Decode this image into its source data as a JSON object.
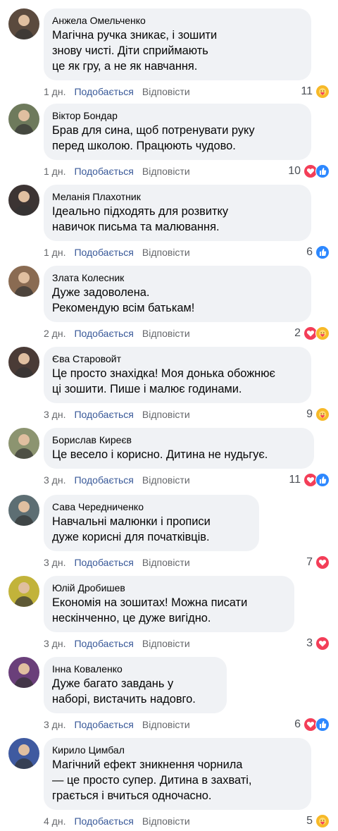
{
  "actions": {
    "like": "Подобається",
    "reply": "Відповісти"
  },
  "comments": [
    {
      "name": "Анжела Омельченко",
      "lines": [
        "Магічна ручка зникає, і зошити",
        "знову чисті. Діти сприймають",
        "це як гру, а не як навчання."
      ],
      "time": "1 дн.",
      "count": "11",
      "reactions": [
        "care"
      ],
      "avatar_color": "#5b4a3e"
    },
    {
      "name": "Віктор Бондар",
      "lines": [
        "Брав для сина, щоб потренувати руку",
        "перед школою. Працюють чудово."
      ],
      "time": "1 дн.",
      "count": "10",
      "reactions": [
        "love",
        "like"
      ],
      "avatar_color": "#6e7a5c"
    },
    {
      "name": "Меланія Плахотник",
      "lines": [
        "Ідеально підходять для розвитку",
        "навичок письма та малювання."
      ],
      "time": "1 дн.",
      "count": "6",
      "reactions": [
        "like"
      ],
      "avatar_color": "#3c3433"
    },
    {
      "name": "Злата Колесник",
      "lines": [
        "Дуже задоволена.",
        "Рекомендую всім батькам!"
      ],
      "time": "2 дн.",
      "count": "2",
      "reactions": [
        "love",
        "care"
      ],
      "avatar_color": "#8a6b52"
    },
    {
      "name": "Єва Старовойт",
      "lines": [
        "Це просто знахідка! Моя донька обожнює",
        "ці зошити. Пише і малює годинами."
      ],
      "time": "3 дн.",
      "count": "9",
      "reactions": [
        "care"
      ],
      "avatar_color": "#4a3b36"
    },
    {
      "name": "Борислав Киреєв",
      "lines": [
        "Це весело і корисно. Дитина не нудьгує."
      ],
      "time": "3 дн.",
      "count": "11",
      "reactions": [
        "love",
        "like"
      ],
      "avatar_color": "#8c9470"
    },
    {
      "name": "Сава Чередниченко",
      "lines": [
        "Навчальні малюнки і прописи",
        "дуже корисні для початківців."
      ],
      "time": "3 дн.",
      "count": "7",
      "reactions": [
        "love"
      ],
      "avatar_color": "#5d6e73"
    },
    {
      "name": "Юлій Дробишев",
      "lines": [
        "Економія на зошитах! Можна писати",
        "нескінченно, це дуже вигідно."
      ],
      "time": "3 дн.",
      "count": "3",
      "reactions": [
        "love"
      ],
      "avatar_color": "#c2b33a"
    },
    {
      "name": "Інна Коваленко",
      "lines": [
        "Дуже багато завдань у",
        "наборі, вистачить надовго."
      ],
      "time": "3 дн.",
      "count": "6",
      "reactions": [
        "love",
        "like"
      ],
      "avatar_color": "#6a3f7a"
    },
    {
      "name": "Кирило Цимбал",
      "lines": [
        "Магічний ефект зникнення чорнила",
        "— це просто супер. Дитина в захваті,",
        "грається і вчиться одночасно."
      ],
      "time": "4 дн.",
      "count": "5",
      "reactions": [
        "care"
      ],
      "avatar_color": "#3f5aa0"
    }
  ]
}
